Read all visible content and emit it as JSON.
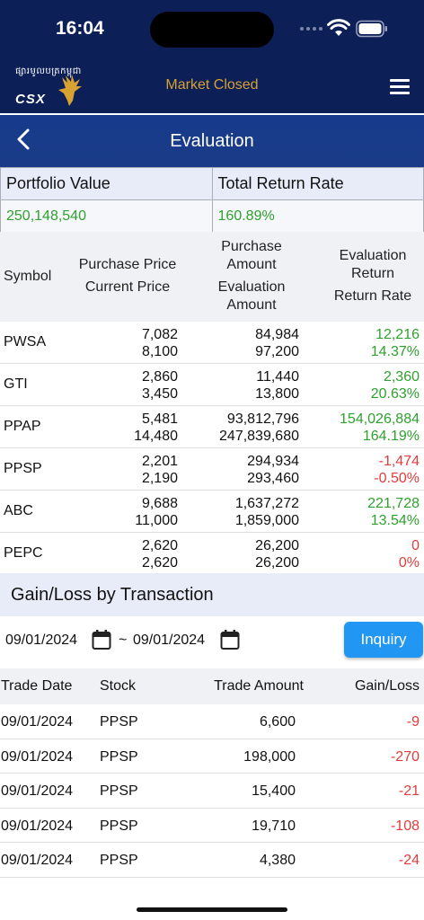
{
  "status_bar": {
    "time": "16:04"
  },
  "header": {
    "logo_khmer": "ផ្សារមូលបត្រកម្ពុជា",
    "logo_text": "CSX",
    "market_status": "Market Closed"
  },
  "titlebar": {
    "title": "Evaluation"
  },
  "summary": {
    "portfolio_value_label": "Portfolio Value",
    "total_return_rate_label": "Total Return Rate",
    "portfolio_value": "250,148,540",
    "total_return_rate": "160.89%"
  },
  "holdings_headers": {
    "symbol": "Symbol",
    "purchase_price": "Purchase Price",
    "current_price": "Current Price",
    "purchase_amount_1": "Purchase",
    "purchase_amount_2": "Amount",
    "evaluation_amount_1": "Evaluation",
    "evaluation_amount_2": "Amount",
    "evaluation_return_1": "Evaluation",
    "evaluation_return_2": "Return",
    "return_rate": "Return Rate"
  },
  "holdings": [
    {
      "symbol": "PWSA",
      "purchase_price": "7,082",
      "current_price": "8,100",
      "purchase_amount": "84,984",
      "evaluation_amount": "97,200",
      "evaluation_return": "12,216",
      "return_rate": "14.37%",
      "tone": "pos"
    },
    {
      "symbol": "GTI",
      "purchase_price": "2,860",
      "current_price": "3,450",
      "purchase_amount": "11,440",
      "evaluation_amount": "13,800",
      "evaluation_return": "2,360",
      "return_rate": "20.63%",
      "tone": "pos"
    },
    {
      "symbol": "PPAP",
      "purchase_price": "5,481",
      "current_price": "14,480",
      "purchase_amount": "93,812,796",
      "evaluation_amount": "247,839,680",
      "evaluation_return": "154,026,884",
      "return_rate": "164.19%",
      "tone": "pos"
    },
    {
      "symbol": "PPSP",
      "purchase_price": "2,201",
      "current_price": "2,190",
      "purchase_amount": "294,934",
      "evaluation_amount": "293,460",
      "evaluation_return": "-1,474",
      "return_rate": "-0.50%",
      "tone": "neg"
    },
    {
      "symbol": "ABC",
      "purchase_price": "9,688",
      "current_price": "11,000",
      "purchase_amount": "1,637,272",
      "evaluation_amount": "1,859,000",
      "evaluation_return": "221,728",
      "return_rate": "13.54%",
      "tone": "pos"
    },
    {
      "symbol": "PEPC",
      "purchase_price": "2,620",
      "current_price": "2,620",
      "purchase_amount": "26,200",
      "evaluation_amount": "26,200",
      "evaluation_return": "0",
      "return_rate": "0%",
      "tone": "neg"
    }
  ],
  "gain_loss": {
    "section_title": "Gain/Loss by Transaction",
    "date_from": "09/01/2024",
    "separator": "~",
    "date_to": "09/01/2024",
    "inquiry_label": "Inquiry",
    "headers": {
      "trade_date": "Trade Date",
      "stock": "Stock",
      "trade_amount": "Trade Amount",
      "gain_loss": "Gain/Loss"
    },
    "rows": [
      {
        "trade_date": "09/01/2024",
        "stock": "PPSP",
        "trade_amount": "6,600",
        "gain_loss": "-9"
      },
      {
        "trade_date": "09/01/2024",
        "stock": "PPSP",
        "trade_amount": "198,000",
        "gain_loss": "-270"
      },
      {
        "trade_date": "09/01/2024",
        "stock": "PPSP",
        "trade_amount": "15,400",
        "gain_loss": "-21"
      },
      {
        "trade_date": "09/01/2024",
        "stock": "PPSP",
        "trade_amount": "19,710",
        "gain_loss": "-108"
      },
      {
        "trade_date": "09/01/2024",
        "stock": "PPSP",
        "trade_amount": "4,380",
        "gain_loss": "-24"
      }
    ]
  },
  "colors": {
    "header_bg": "#0c1f57",
    "title_bg": "#1a3c87",
    "accent_gold": "#d8a233",
    "positive": "#2ea12e",
    "negative": "#e23c3c",
    "button": "#2196f3"
  },
  "icons": [
    "wifi-icon",
    "battery-icon",
    "menu-icon",
    "back-chevron-icon",
    "calendar-icon"
  ]
}
